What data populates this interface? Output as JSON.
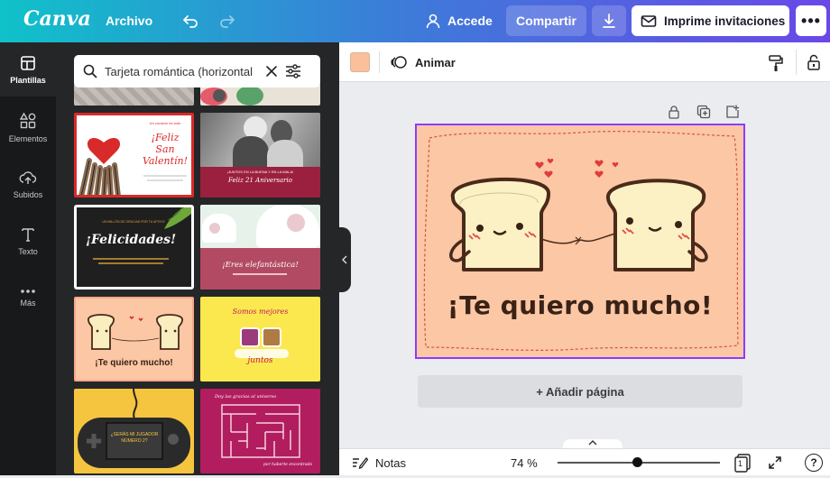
{
  "topbar": {
    "logo": "Canva",
    "archivo": "Archivo",
    "accede": "Accede",
    "share_label": "Compartir",
    "print_label": "Imprime invitaciones",
    "more_label": "•••"
  },
  "nav": [
    {
      "label": "Plantillas",
      "icon": "templates-icon"
    },
    {
      "label": "Elementos",
      "icon": "elements-icon"
    },
    {
      "label": "Subidos",
      "icon": "upload-icon"
    },
    {
      "label": "Texto",
      "icon": "text-icon"
    },
    {
      "label": "Más",
      "icon": "more-icon"
    }
  ],
  "search": {
    "value": "Tarjeta romántica (horizontal"
  },
  "templates": {
    "t1": {
      "small": "Un corazón es todo",
      "title1": "¡Feliz",
      "title2": "San",
      "title3": "Valentín!"
    },
    "t2": {
      "small": "¡JUNTOS EN LA BUENA Y EN LA MALA!",
      "title": "Feliz 21 Aniversario"
    },
    "t3": {
      "small": "UN MILLÓN DE GRACIAS POR TU APOYO",
      "title": "¡Felicidades!"
    },
    "t4": {
      "title": "¡Eres elefantástica!"
    },
    "t5": {
      "title": "¡Te quiero mucho!"
    },
    "t6": {
      "title1": "Somos mejores",
      "title2": "juntos"
    },
    "t7": {
      "line1": "¿SERÁS MI JUGADOR",
      "line2": "NÚMERO 2?"
    },
    "t8": {
      "title": "Doy las gracias al universo",
      "footer": "por haberte encontrado"
    }
  },
  "editor": {
    "animar": "Animar",
    "swatch_color": "#fbbf9b",
    "design_text": "¡Te quiero mucho!",
    "add_page": "+ Añadir página",
    "notes": "Notas",
    "zoom": "74 %",
    "zoom_fraction": 0.49,
    "page_number": "1",
    "help": "?"
  },
  "colors": {
    "accent": "#8b3dff",
    "canvas_bg": "#fbc7a5",
    "text_brown": "#4a2a1a"
  }
}
